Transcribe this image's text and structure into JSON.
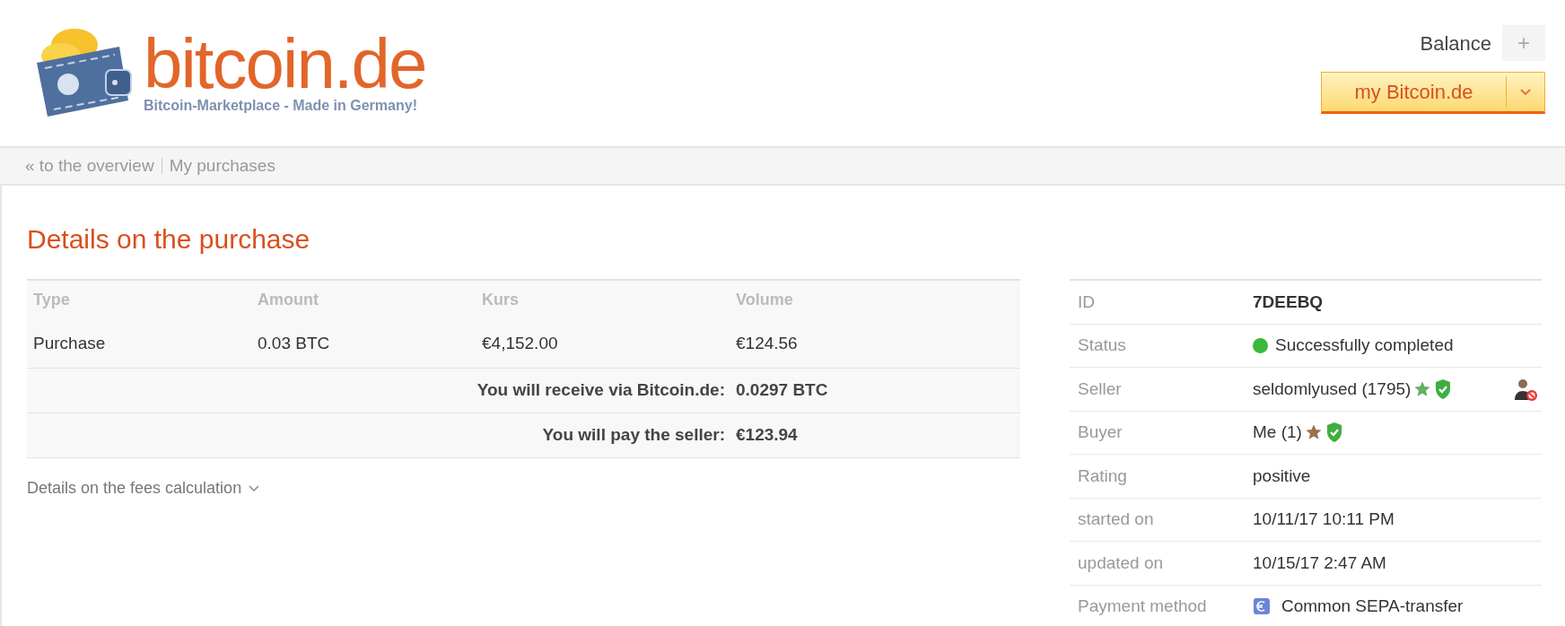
{
  "logo": {
    "name": "bitcoin.de",
    "tagline": "Bitcoin-Marketplace - Made in Germany!"
  },
  "header": {
    "balance_label": "Balance",
    "balance_toggle": "+",
    "account_button": "my Bitcoin.de"
  },
  "breadcrumb": [
    "« to the overview",
    "My purchases"
  ],
  "page_title": "Details on the purchase",
  "trade_table": {
    "columns": [
      "Type",
      "Amount",
      "Kurs",
      "Volume"
    ],
    "rows": [
      [
        "Purchase",
        "0.03 BTC",
        "€4,152.00",
        "€124.56"
      ]
    ],
    "summary": [
      {
        "label": "You will receive via Bitcoin.de:",
        "value": "0.0297 BTC"
      },
      {
        "label": "You will pay the seller:",
        "value": "€123.94"
      }
    ]
  },
  "fees_toggle": {
    "label": "Details on the fees calculation",
    "expanded": false
  },
  "details": [
    {
      "label": "ID",
      "value": "7DEEBQ",
      "kind": "bold"
    },
    {
      "label": "Status",
      "value": "Successfully completed",
      "kind": "status",
      "color": "#3cb83c"
    },
    {
      "label": "Seller",
      "value": "seldomlyused (1795)",
      "kind": "party",
      "color": "#5cb85c",
      "verified": true,
      "blockable": true
    },
    {
      "label": "Buyer",
      "value": "Me (1)",
      "kind": "party",
      "color": "#a0704a",
      "verified": true,
      "blockable": false
    },
    {
      "label": "Rating",
      "value": "positive",
      "kind": "text"
    },
    {
      "label": "started on",
      "value": "10/11/17 10:11 PM",
      "kind": "text"
    },
    {
      "label": "updated on",
      "value": "10/15/17 2:47 AM",
      "kind": "text"
    },
    {
      "label": "Payment method",
      "value": "Common SEPA-transfer",
      "kind": "payment"
    }
  ]
}
